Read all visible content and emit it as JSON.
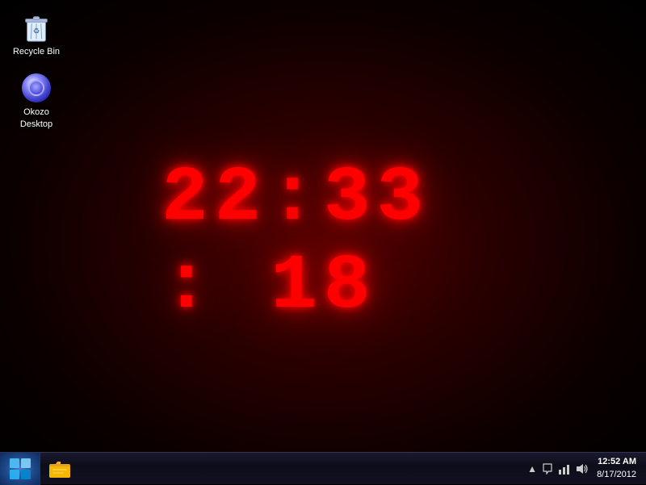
{
  "desktop": {
    "background": "dark red radial"
  },
  "icons": [
    {
      "id": "recycle-bin",
      "label": "Recycle Bin",
      "type": "recycle-bin"
    },
    {
      "id": "okozo-desktop",
      "label": "Okozo Desktop",
      "type": "okozo"
    }
  ],
  "clock": {
    "hours": "22",
    "minutes": "33",
    "seconds": "18",
    "display": "22:33: 18"
  },
  "taskbar": {
    "start_label": "Start",
    "icons": [
      {
        "id": "start",
        "label": "Start"
      },
      {
        "id": "explorer",
        "label": "Windows Explorer"
      }
    ]
  },
  "systemtray": {
    "time": "12:52 AM",
    "date": "8/17/2012",
    "icons": [
      {
        "id": "arrow",
        "label": "Show hidden icons",
        "symbol": "▲"
      },
      {
        "id": "flag",
        "label": "Action Center",
        "symbol": "⚑"
      },
      {
        "id": "network",
        "label": "Network",
        "symbol": "🖧"
      },
      {
        "id": "volume",
        "label": "Volume",
        "symbol": "🔊"
      }
    ]
  }
}
